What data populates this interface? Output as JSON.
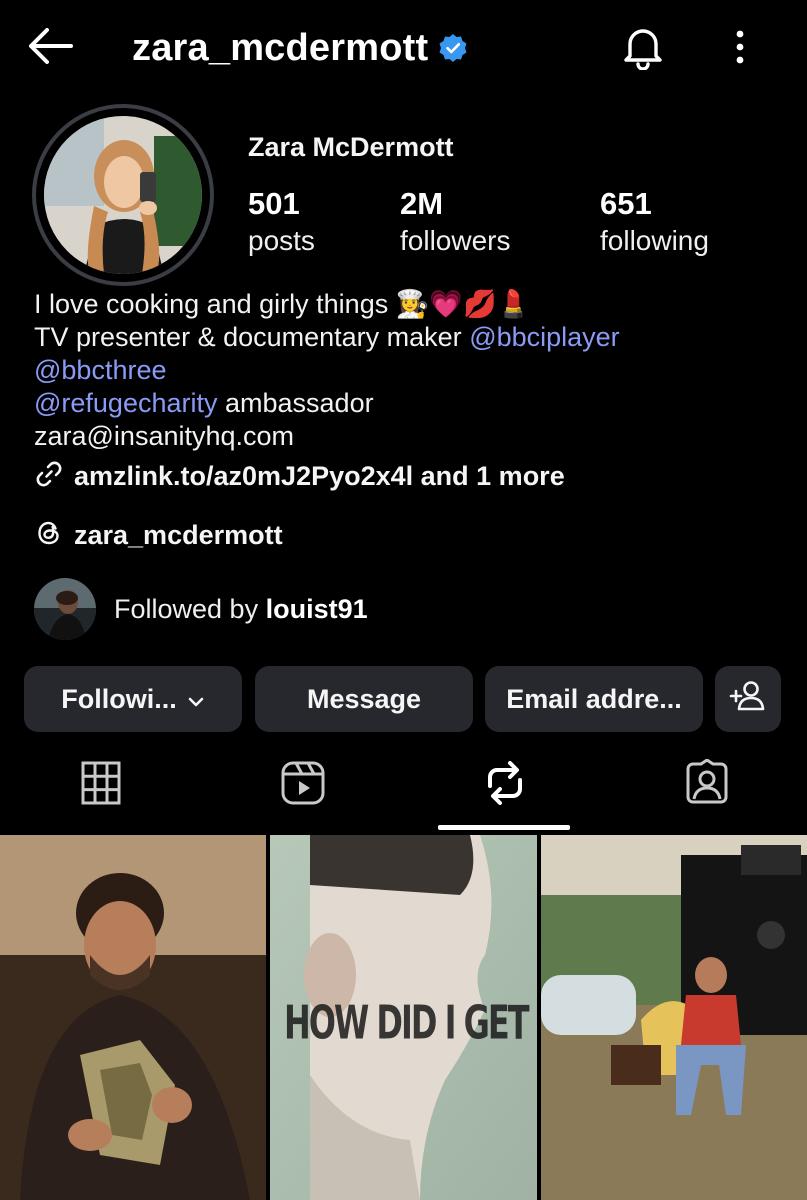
{
  "header": {
    "username": "zara_mcdermott",
    "icons": {
      "back": "arrow-left-icon",
      "verified": "verified-badge-icon",
      "bell": "bell-icon",
      "more": "more-vertical-icon"
    }
  },
  "profile": {
    "display_name": "Zara McDermott",
    "stats": {
      "posts": {
        "value": "501",
        "label": "posts"
      },
      "followers": {
        "value": "2M",
        "label": "followers"
      },
      "following": {
        "value": "651",
        "label": "following"
      }
    },
    "bio": {
      "line1": "I love cooking and girly things 👩‍🍳💗💋💄",
      "line2_text": "TV presenter & documentary maker ",
      "line2_mention": "@bbciplayer",
      "line3_mention": "@bbcthree",
      "line4_mention": "@refugecharity",
      "line4_text": " ambassador",
      "line5": "zara@insanityhq.com"
    },
    "link": "amzlink.to/az0mJ2Pyo2x4l and 1 more",
    "threads_handle": "zara_mcdermott",
    "followed_by_prefix": "Followed by ",
    "followed_by_user": "louist91"
  },
  "actions": {
    "following": "Followi...",
    "message": "Message",
    "email": "Email addre..."
  },
  "tabs": {
    "active": "reposts",
    "items": [
      "grid-icon",
      "reels-icon",
      "reposts-icon",
      "tagged-icon"
    ]
  },
  "grid": {
    "posts": [
      {
        "overlay_text": ""
      },
      {
        "overlay_text": "HOW DID I GET HERE?"
      },
      {
        "overlay_text": ""
      }
    ]
  },
  "colors": {
    "background": "#000000",
    "button_bg": "#26282e",
    "mention": "#8a9bf5",
    "verified": "#3897f0"
  }
}
